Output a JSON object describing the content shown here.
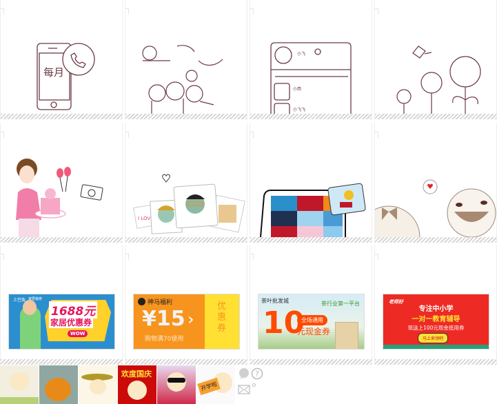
{
  "colors": {
    "line": "#6b3a44",
    "stripe": "#d6d6d6"
  },
  "skins": [
    {
      "id": "monthly-phone",
      "text": "每月"
    },
    {
      "id": "sun-moon-friends"
    },
    {
      "id": "contact-list",
      "names": [
        "小飞",
        "小西",
        "小飞飞"
      ]
    },
    {
      "id": "sunflowers"
    },
    {
      "id": "girl-cake"
    },
    {
      "id": "avatar-cards",
      "note_text": "I LOVE mom"
    },
    {
      "id": "photo-tablet"
    },
    {
      "id": "round-faces"
    }
  ],
  "ads": [
    {
      "brand": "土巴兔",
      "sub": "家居装修",
      "amount": "1688元",
      "title": "家居优惠券",
      "badge": "WOW"
    },
    {
      "brand": "神马福利",
      "amount": "¥15",
      "condition": "购物满70使用",
      "side": "优惠券"
    },
    {
      "brand": "茶叶批发城",
      "slogan": "茶行业第一平台",
      "amount": "10",
      "tag": "全场通用",
      "title": "元现金券"
    },
    {
      "brand": "老师好",
      "line1": "专注中小学",
      "line2": "一对一教育辅导",
      "line3": "现送上100元现金抵用券",
      "button": "马上来领吧"
    }
  ],
  "thumbs": [
    {
      "id": "garden"
    },
    {
      "id": "pumpkin"
    },
    {
      "id": "straw-hat"
    },
    {
      "id": "national-day",
      "text": "欢度国庆"
    },
    {
      "id": "sunglasses"
    },
    {
      "id": "school",
      "text": "开学啦"
    }
  ],
  "icons": [
    "chat-bubble-icon",
    "help-icon",
    "mail-icon"
  ]
}
